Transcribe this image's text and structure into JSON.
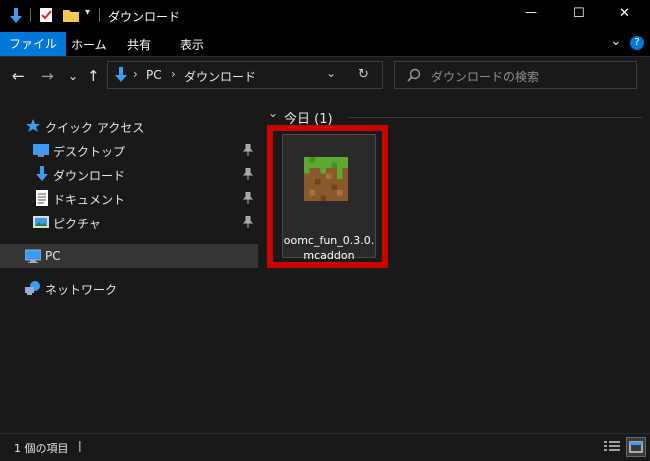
{
  "window": {
    "title": "ダウンロード",
    "qat": {
      "customize_glyph": "▾"
    },
    "controls": {
      "minimize": "—",
      "maximize": "☐",
      "close": "✕"
    }
  },
  "ribbon": {
    "tabs": [
      {
        "label": "ファイル",
        "active": true
      },
      {
        "label": "ホーム"
      },
      {
        "label": "共有"
      },
      {
        "label": "表示"
      }
    ],
    "collapse_glyph": "⌄",
    "help_glyph": "?"
  },
  "address_bar": {
    "back": "←",
    "forward": "→",
    "recent": "⌄",
    "up": "↑",
    "path": [
      "PC",
      "ダウンロード"
    ],
    "separator": "›",
    "dropdown": "⌄",
    "refresh": "↻"
  },
  "search": {
    "placeholder": "ダウンロードの検索",
    "icon": "search-icon"
  },
  "nav_pane": {
    "quick_access": {
      "label": "クイック アクセス",
      "icon": "star-icon"
    },
    "pinned": [
      {
        "label": "デスクトップ",
        "icon": "desktop-icon"
      },
      {
        "label": "ダウンロード",
        "icon": "download-icon"
      },
      {
        "label": "ドキュメント",
        "icon": "document-icon"
      },
      {
        "label": "ピクチャ",
        "icon": "pictures-icon"
      }
    ],
    "pc": {
      "label": "PC",
      "icon": "pc-icon"
    },
    "network": {
      "label": "ネットワーク",
      "icon": "network-icon"
    }
  },
  "content": {
    "group": {
      "label": "今日 (1)",
      "chevron": "⌄"
    },
    "files": [
      {
        "name_line1": "oomc_fun_0.3.0.",
        "name_line2": "mcaddon",
        "icon": "minecraft-grass-block-icon"
      }
    ]
  },
  "status_bar": {
    "item_count": "1 個の項目",
    "separator": "|",
    "views": [
      "details-view-icon",
      "large-icons-view-icon"
    ]
  },
  "colors": {
    "accent": "#0078d7",
    "highlight_box": "#c80000",
    "selected_nav": "#353535",
    "background": "#191919"
  }
}
